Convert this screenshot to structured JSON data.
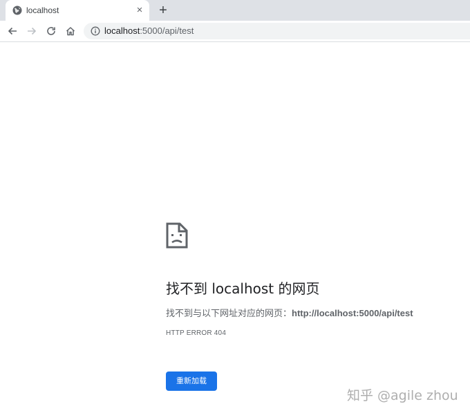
{
  "browser": {
    "tab": {
      "title": "localhost",
      "close_glyph": "×"
    },
    "new_tab_glyph": "+",
    "address_bar": {
      "host": "localhost",
      "path": ":5000/api/test"
    },
    "icons": [
      "globe-icon",
      "close-icon",
      "plus-icon",
      "back-icon",
      "forward-icon",
      "reload-icon",
      "home-icon",
      "info-icon"
    ]
  },
  "error_page": {
    "icon": "sad-document-icon",
    "title": "找不到 localhost 的网页",
    "description_prefix": "找不到与以下网址对应的网页：",
    "description_url": "http://localhost:5000/api/test",
    "error_code": "HTTP ERROR 404",
    "reload_label": "重新加载",
    "accent_color": "#1a73e8"
  },
  "watermark": "知乎 @agile zhou"
}
